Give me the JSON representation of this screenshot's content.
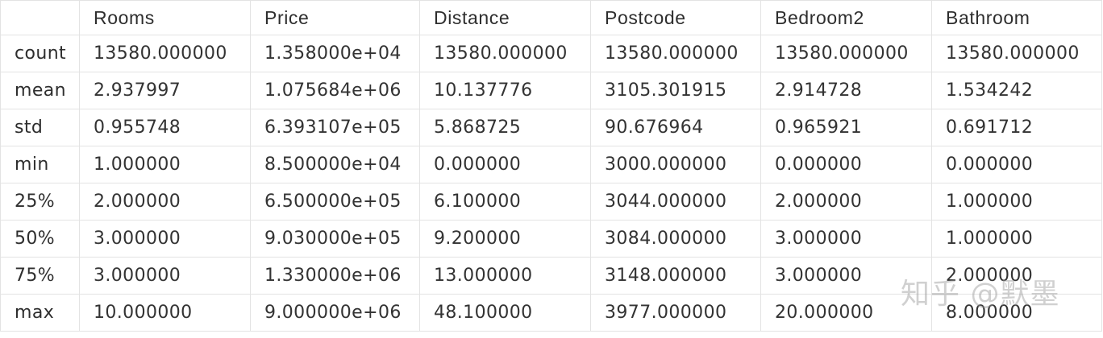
{
  "table": {
    "columns": [
      "",
      "Rooms",
      "Price",
      "Distance",
      "Postcode",
      "Bedroom2",
      "Bathroom"
    ],
    "rows": [
      {
        "label": "count",
        "values": [
          "13580.000000",
          "1.358000e+04",
          "13580.000000",
          "13580.000000",
          "13580.000000",
          "13580.000000"
        ]
      },
      {
        "label": "mean",
        "values": [
          "2.937997",
          "1.075684e+06",
          "10.137776",
          "3105.301915",
          "2.914728",
          "1.534242"
        ]
      },
      {
        "label": "std",
        "values": [
          "0.955748",
          "6.393107e+05",
          "5.868725",
          "90.676964",
          "0.965921",
          "0.691712"
        ]
      },
      {
        "label": "min",
        "values": [
          "1.000000",
          "8.500000e+04",
          "0.000000",
          "3000.000000",
          "0.000000",
          "0.000000"
        ]
      },
      {
        "label": "25%",
        "values": [
          "2.000000",
          "6.500000e+05",
          "6.100000",
          "3044.000000",
          "2.000000",
          "1.000000"
        ]
      },
      {
        "label": "50%",
        "values": [
          "3.000000",
          "9.030000e+05",
          "9.200000",
          "3084.000000",
          "3.000000",
          "1.000000"
        ]
      },
      {
        "label": "75%",
        "values": [
          "3.000000",
          "1.330000e+06",
          "13.000000",
          "3148.000000",
          "3.000000",
          "2.000000"
        ]
      },
      {
        "label": "max",
        "values": [
          "10.000000",
          "9.000000e+06",
          "48.100000",
          "3977.000000",
          "20.000000",
          "8.000000"
        ]
      }
    ]
  },
  "watermark": {
    "text": "知乎 @默墨"
  },
  "colors": {
    "border": "#e3e3e3",
    "text": "#333333",
    "watermark": "#969696"
  }
}
